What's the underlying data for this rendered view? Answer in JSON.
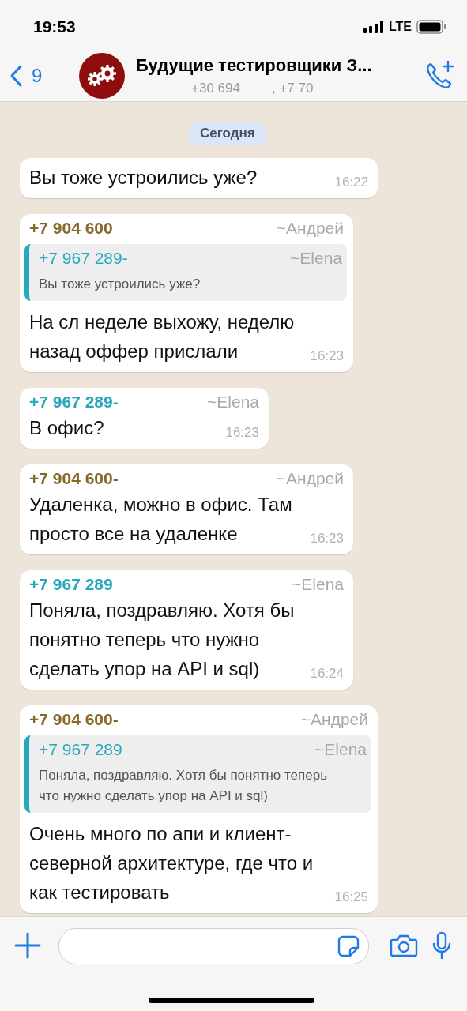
{
  "status_bar": {
    "time": "19:53",
    "network": "LTE"
  },
  "header": {
    "back_count": "9",
    "title": "Будущие тестировщики З...",
    "subtitle_parts": [
      "+30 694",
      ", +7 70"
    ]
  },
  "date_chip": "Сегодня",
  "messages": [
    {
      "kind": "plain",
      "text": "Вы тоже устроились уже?",
      "time": "16:22"
    },
    {
      "kind": "quoted",
      "sender": "+7 904 600",
      "name": "~Андрей",
      "color": "#86692a",
      "quote": {
        "sender": "+7 967 289-",
        "name": "~Elena",
        "color": "#27a8bd",
        "text": "Вы тоже устроились уже?"
      },
      "text": "На сл неделе выхожу, неделю назад оффер прислали",
      "time": "16:23"
    },
    {
      "kind": "named",
      "sender": "+7 967 289-",
      "name": "~Elena",
      "color": "#27a8bd",
      "text": "В офис?",
      "time": "16:23"
    },
    {
      "kind": "named",
      "sender": "+7 904 600-",
      "name": "~Андрей",
      "color": "#86692a",
      "text": "Удаленка, можно в офис. Там просто все на удаленке",
      "time": "16:23"
    },
    {
      "kind": "named",
      "sender": "+7 967 289",
      "name": "~Elena",
      "color": "#27a8bd",
      "text": "Поняла, поздравляю. Хотя бы понятно теперь что нужно сделать упор на API и sql)",
      "time": "16:24"
    },
    {
      "kind": "quoted",
      "sender": "+7 904 600-",
      "name": "~Андрей",
      "color": "#86692a",
      "quote": {
        "sender": "+7 967 289",
        "name": "~Elena",
        "color": "#27a8bd",
        "text": "Поняла, поздравляю. Хотя бы понятно теперь что нужно сделать упор на API и sql)"
      },
      "text": "Очень много по апи и клиент-северной архитектуре, где что и как тестировать",
      "time": "16:25"
    }
  ]
}
